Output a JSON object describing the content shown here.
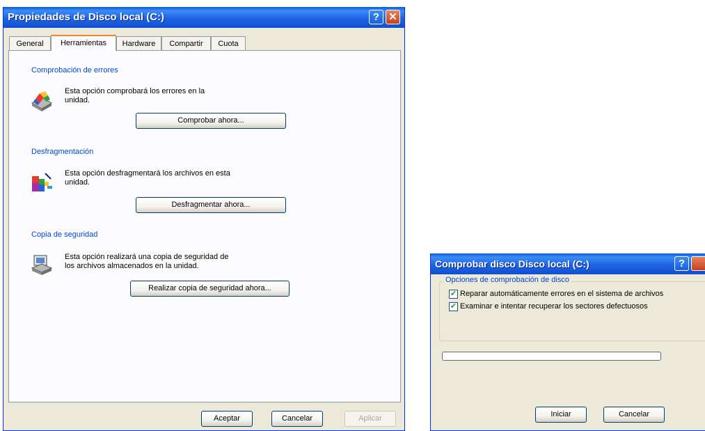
{
  "properties_window": {
    "title": "Propiedades de Disco local (C:)",
    "help_glyph": "?",
    "close_glyph": "✕",
    "tabs": [
      "General",
      "Herramientas",
      "Hardware",
      "Compartir",
      "Cuota"
    ],
    "active_tab": "Herramientas",
    "sections": {
      "error_check": {
        "title": "Comprobación de errores",
        "description_line1": "Esta opción comprobará los errores en la",
        "description_line2": "unidad.",
        "button": "Comprobar ahora...",
        "icon": "disk-check-icon"
      },
      "defrag": {
        "title": "Desfragmentación",
        "description_line1": "Esta opción desfragmentará los archivos en esta",
        "description_line2": "unidad.",
        "button": "Desfragmentar ahora...",
        "icon": "defrag-icon"
      },
      "backup": {
        "title": "Copia de seguridad",
        "description_line1": "Esta opción realizará una copia de seguridad de",
        "description_line2": "los archivos almacenados en la unidad.",
        "button": "Realizar copia de seguridad ahora...",
        "icon": "backup-icon"
      }
    },
    "footer": {
      "ok": "Aceptar",
      "cancel": "Cancelar",
      "apply": "Aplicar"
    }
  },
  "check_disk_window": {
    "title": "Comprobar disco Disco local (C:)",
    "help_glyph": "?",
    "group_title": "Opciones de comprobación de disco",
    "options": [
      {
        "label": "Reparar automáticamente errores en el sistema de archivos",
        "checked": true
      },
      {
        "label": "Examinar e intentar recuperar los sectores defectuosos",
        "checked": true
      }
    ],
    "check_glyph": "✔",
    "progress": 0,
    "start_button": "Iniciar",
    "cancel_button": "Cancelar"
  },
  "colors": {
    "titlebar_blue": "#1f64e4",
    "section_title": "#0046d5",
    "dialog_bg": "#ece9d8",
    "tab_accent": "#e68b2c"
  }
}
